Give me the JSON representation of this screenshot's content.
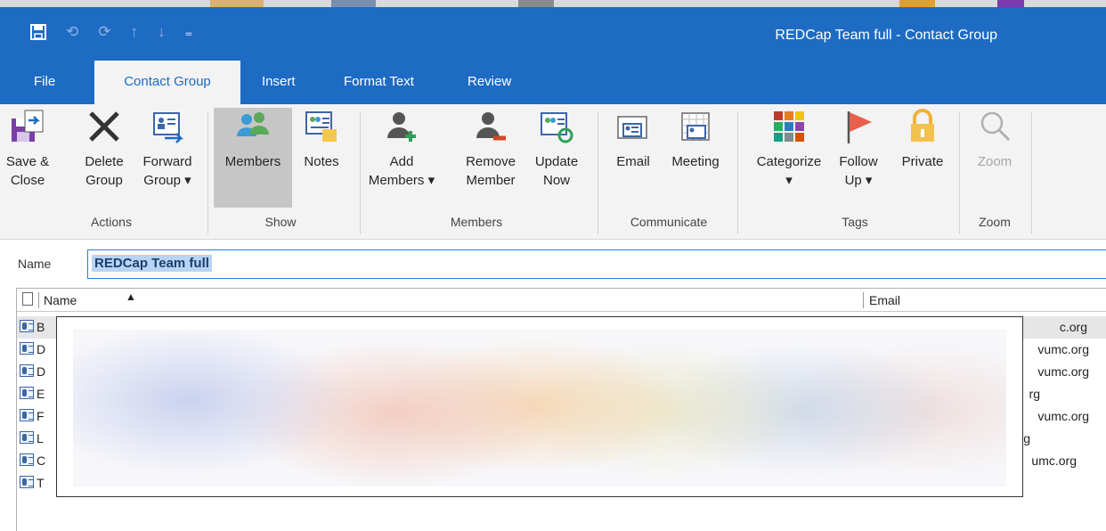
{
  "window": {
    "title": "REDCap Team full  -  Contact Group"
  },
  "quick_access": {
    "save_icon": "floppy-save-icon",
    "undo_icon": "undo-icon",
    "redo_icon": "redo-icon",
    "up_icon": "arrow-up-icon",
    "down_icon": "arrow-down-icon",
    "customize_icon": "customize-toolbar-icon"
  },
  "tabs": [
    {
      "label": "File"
    },
    {
      "label": "Contact Group"
    },
    {
      "label": "Insert"
    },
    {
      "label": "Format Text"
    },
    {
      "label": "Review"
    }
  ],
  "ribbon": {
    "actions": {
      "group_label": "Actions",
      "save_close": {
        "line1": "Save &",
        "line2": "Close"
      },
      "delete_group": {
        "line1": "Delete",
        "line2": "Group"
      },
      "forward_group": {
        "line1": "Forward",
        "line2": "Group ▾"
      }
    },
    "show": {
      "group_label": "Show",
      "members": "Members",
      "notes": "Notes"
    },
    "members": {
      "group_label": "Members",
      "add_members": {
        "line1": "Add",
        "line2": "Members ▾"
      },
      "remove_member": {
        "line1": "Remove",
        "line2": "Member"
      },
      "update_now": {
        "line1": "Update",
        "line2": "Now"
      }
    },
    "communicate": {
      "group_label": "Communicate",
      "email": "Email",
      "meeting": "Meeting"
    },
    "tags": {
      "group_label": "Tags",
      "categorize": {
        "line1": "Categorize",
        "line2": "▾"
      },
      "follow_up": {
        "line1": "Follow",
        "line2": "Up ▾"
      },
      "private": "Private"
    },
    "zoom": {
      "group_label": "Zoom",
      "zoom": "Zoom"
    }
  },
  "name_field": {
    "label": "Name",
    "value": "REDCap Team full"
  },
  "member_list": {
    "columns": {
      "name": "Name",
      "email": "Email",
      "sort_indicator": "▲"
    },
    "rows": [
      {
        "first_letter": "B",
        "email_tail": "c.org"
      },
      {
        "first_letter": "D",
        "email_tail": "vumc.org"
      },
      {
        "first_letter": "D",
        "email_tail": "vumc.org"
      },
      {
        "first_letter": "E",
        "email_tail": "rg"
      },
      {
        "first_letter": "F",
        "email_tail": "vumc.org"
      },
      {
        "first_letter": "L",
        "email_tail": "g"
      },
      {
        "first_letter": "C",
        "email_tail": "umc.org"
      },
      {
        "first_letter": "T",
        "email_tail": ""
      }
    ]
  },
  "colors": {
    "accent": "#1e6bc4",
    "ribbon_bg": "#f3f3f3",
    "selected_button": "#c6c6c6"
  }
}
